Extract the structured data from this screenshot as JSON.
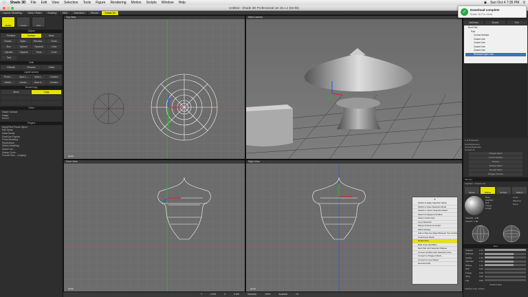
{
  "menubar": {
    "app": "Shade 3D",
    "items": [
      "File",
      "Edit",
      "View",
      "Selection",
      "Tools",
      "Figure",
      "Rendering",
      "Motion",
      "Scripts",
      "Window",
      "Help"
    ],
    "clock": "Sun Oct 4 7:35 PM"
  },
  "window": {
    "title": "Untitled - Shade 3D Professional ver.15.1.2 (64-bit)"
  },
  "toolstrip": {
    "items": [
      "Layout / Modeling",
      "Undo / Redo",
      "Shading",
      "Wire",
      "Animation",
      "Render",
      "Shade 3D"
    ]
  },
  "left_panel": {
    "tabs": [
      "Modify",
      "Create",
      "View"
    ],
    "object_section": "Object",
    "object_modes": [
      "Primitive",
      "Surface",
      "Mesh"
    ],
    "object_row2": [
      "Closed...",
      "Open...",
      "Revolve...",
      "Circle"
    ],
    "object_row3": [
      "Box",
      "Sphere",
      "Pyramid",
      "Cube"
    ],
    "object_row4": [
      "Cylinder",
      "Capsule",
      "Torus",
      "Cone"
    ],
    "object_row5": [
      "Text"
    ],
    "edit_section": "Edit",
    "edit_row1": [
      "Extrude",
      "Revolve",
      "Close"
    ],
    "light_section": "Light/Camera",
    "light_row": [
      "Point L...",
      "Spot L...",
      "Area L...",
      "Camera"
    ],
    "light_row2": [
      "Ambie...",
      "Linear...",
      "Area Li...",
      "Camera"
    ],
    "move_section": "Move/Copy",
    "move_modes": [
      "Move",
      "Copy"
    ],
    "other_section": "Other",
    "other_items": [
      "Master Surface",
      "Image",
      "Sound"
    ],
    "plugin_section": "Plugins",
    "plugins": [
      "Depth/Fine Praxis Object",
      "Hair Spray",
      "Metal Shade",
      "PaveLine Physics",
      "Photo Modeling...",
      "Replications",
      "Sketch Modeling...",
      "Spiral Line...",
      "Sweep Circle...",
      "Formed Skin... (Legacy)"
    ]
  },
  "viewports": {
    "top_view": {
      "label": "Top View",
      "footer": "global"
    },
    "main_camera": {
      "label": "Main Camera",
      "footer": ""
    },
    "front_view": {
      "label": "Front View",
      "footer": "global"
    },
    "right_view": {
      "label": "Right View",
      "footer": "global"
    }
  },
  "right_panel": {
    "tabs": [
      "Attributes",
      "Shader",
      "Fine"
    ],
    "tree": [
      {
        "label": "Root Part",
        "selected": false
      },
      {
        "label": "Part",
        "selected": false
      },
      {
        "label": "Curved Surface",
        "selected": false
      },
      {
        "label": "Closed Line",
        "selected": false
      },
      {
        "label": "Closed Line",
        "selected": false
      },
      {
        "label": "Closed Line",
        "selected": false
      },
      {
        "label": "Closed Line",
        "selected": false
      },
      {
        "label": "Revolved Open Line",
        "selected": true
      }
    ],
    "selected_count": "1 of 8 selected",
    "tool_params": "Tool Parameters",
    "convert_header": "Convert/Materials",
    "convert_to": "Convert To:",
    "convert_buttons": [
      "Polygon Mesh",
      "Curved Surface",
      "Polyline",
      "Surface Patch",
      "Smooth Patch",
      "Polygon Surface"
    ],
    "memory": "Memory",
    "surface_header": "Highlight - Closed Line",
    "mat_tabs": [
      "Master",
      "Diffuse",
      "Surface",
      "Reflect"
    ],
    "mat_props": [
      "Base",
      "Highlight",
      "Refl.",
      "Transp.",
      "Rough"
    ],
    "mapping": [
      "Layer...",
      "Mapping",
      "Bump"
    ],
    "intensity_label": "Intensity",
    "intensity": "1.00",
    "amount_label": "Amount",
    "amount": "1.00",
    "misc_header": "Misc",
    "sliders": [
      {
        "label": "Shadow",
        "value": "1.00",
        "frac": 1.0
      },
      {
        "label": "Softness",
        "value": "1.00",
        "frac": 0.7
      },
      {
        "label": "Quality",
        "value": "1.00",
        "frac": 0.7
      },
      {
        "label": "Specular",
        "value": "1.00",
        "frac": 0.7
      },
      {
        "label": "Diffuse",
        "value": "1.00",
        "frac": 0.7
      },
      {
        "label": "Refl.",
        "value": "0.00",
        "frac": 0.0
      },
      {
        "label": "Transp.",
        "value": "0.00",
        "frac": 0.0
      },
      {
        "label": "Glow",
        "value": "0.00",
        "frac": 0.0
      },
      {
        "label": "Fog",
        "value": "0.00",
        "frac": 0.0
      }
    ],
    "shade_map": "Shadow Map",
    "shadow_type": "Shadow Type: Infinite"
  },
  "context_menu": {
    "items": [
      {
        "label": "Switch to Edge Selection Mode",
        "hl": false
      },
      {
        "label": "Switch to Face Selection Mode",
        "hl": false
      },
      {
        "label": "Switch to Vertex Selection Mode",
        "hl": false
      },
      {
        "label": "Select Contiguous Surface",
        "hl": false
      },
      {
        "label": "Select Inside Area",
        "hl": false
      },
      {
        "label": "Loop Selection",
        "hl": false
      },
      {
        "label": "Merge Vertices at Center",
        "hl": false
      },
      {
        "label": "Weld Vertices",
        "hl": false
      },
      {
        "label": "Add or Remove Edge Between Two Vertices",
        "hl": false
      },
      {
        "label": "Continuous Mode",
        "hl": false
      },
      {
        "label": "Delete Row",
        "hl": true
      },
      {
        "label": "Both Front and Back",
        "hl": false
      },
      {
        "label": "New Part with Selected Shapes",
        "hl": false
      },
      {
        "label": "Convert Surface with Selected Lines",
        "hl": false
      },
      {
        "label": "Convert to Polygon Mesh...",
        "hl": false
      },
      {
        "label": "Convert to Line Object",
        "hl": false
      },
      {
        "label": "Revolved Obj",
        "hl": false
      }
    ]
  },
  "notification": {
    "title": "Download complete",
    "subtitle": "Shade 3D Pro 15x64"
  },
  "status": {
    "items": [
      "Y",
      "0.000",
      "Z",
      "0.000",
      "Selection",
      "100%",
      "Available",
      "Clr"
    ]
  },
  "colors": {
    "accent": "#e5e300",
    "viewport": "#6c6c6c",
    "wire": "#ffffff",
    "grid": "#7a7a7a"
  }
}
